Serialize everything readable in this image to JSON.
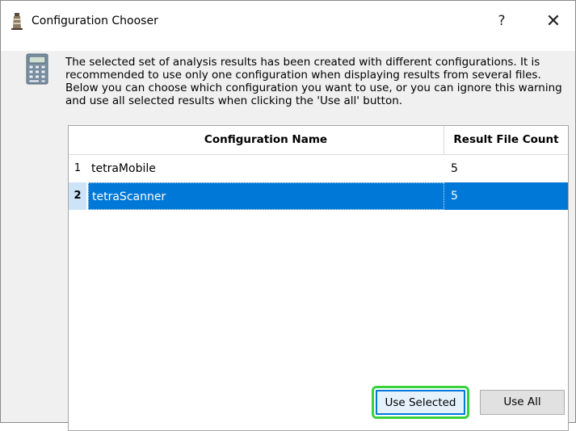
{
  "window": {
    "title": "Configuration Chooser",
    "help_label": "?",
    "close_label": "✕"
  },
  "message": {
    "text": "The selected set of analysis results has been created with different configurations. It is recommended to use only one configuration when displaying results from several files. Below you can choose which configuration you want to use, or you can ignore this warning and use all selected results when clicking the 'Use all' button."
  },
  "table": {
    "columns": [
      "Configuration Name",
      "Result File Count"
    ],
    "rows": [
      {
        "num": "1",
        "name": "tetraMobile",
        "count": "5",
        "selected": false
      },
      {
        "num": "2",
        "name": "tetraScanner",
        "count": "5",
        "selected": true
      }
    ]
  },
  "buttons": {
    "use_selected": "Use Selected",
    "use_all": "Use All"
  },
  "colors": {
    "selection": "#0078d7",
    "highlight_outline": "#37d23a"
  },
  "icons": {
    "title": "lighthouse-icon",
    "message": "calculator-icon"
  }
}
